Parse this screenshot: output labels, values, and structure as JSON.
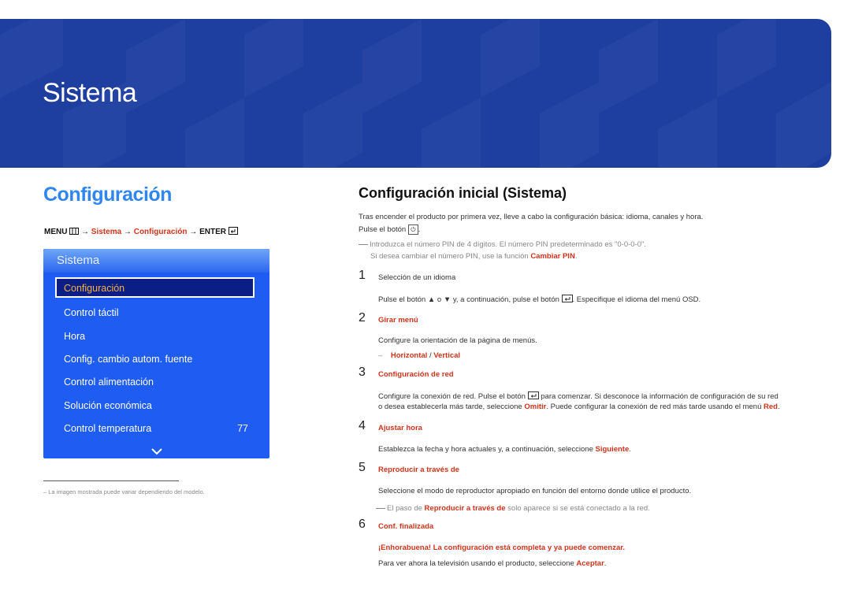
{
  "banner": {
    "title": "Sistema",
    "color": "#1f3fa0"
  },
  "section": {
    "title": "Configuración",
    "title_color": "#2f86f0"
  },
  "path": {
    "menu": "MENU",
    "arrow": "→",
    "item1": "Sistema",
    "item2": "Configuración",
    "enter": "ENTER"
  },
  "osd": {
    "title": "Sistema",
    "items": [
      {
        "label": "Configuración",
        "selected": true
      },
      {
        "label": "Control táctil"
      },
      {
        "label": "Hora"
      },
      {
        "label": "Config. cambio autom. fuente"
      },
      {
        "label": "Control alimentación"
      },
      {
        "label": "Solución económica"
      },
      {
        "label": "Control temperatura",
        "value": "77"
      }
    ]
  },
  "footnote": "La imagen mostrada puede variar dependiendo del modelo.",
  "main": {
    "title": "Configuración inicial (Sistema)",
    "intro1": "Tras encender el producto por primera vez, lleve a cabo la configuración básica: idioma, canales y hora.",
    "intro2a": "Pulse el botón",
    "intro2b": ".",
    "note1": "Introduzca el número PIN de 4 dígitos. El número PIN predeterminado es \"0-0-0-0\".",
    "note2a": "Si desea cambiar el número PIN, use la función",
    "note2b": "Cambiar PIN",
    "note2c": ".",
    "steps": [
      {
        "num": "1",
        "title": "Selección de un idioma",
        "body_a": "Pulse el botón ▲ o ▼ y, a continuación, pulse el botón",
        "body_b": ". Especifique el idioma del menú OSD."
      },
      {
        "num": "2",
        "title": "Girar menú",
        "body": "Configure la orientación de la página de menús.",
        "opt1": "Horizontal",
        "sep": " / ",
        "opt2": "Vertical"
      },
      {
        "num": "3",
        "title": "Configuración de red",
        "body_a": "Configure la conexión de red. Pulse el botón",
        "body_b": "para comenzar. Si desconoce la información de configuración de su red",
        "body_c": "o desea establecerla más tarde, seleccione",
        "body_d": "Omitir",
        "body_e": ". Puede configurar la conexión de red más tarde usando el menú",
        "body_f": "Red",
        "body_g": "."
      },
      {
        "num": "4",
        "title": "Ajustar hora",
        "body_a": "Establezca la fecha y hora actuales y, a continuación, seleccione",
        "body_b": "Siguiente",
        "body_c": "."
      },
      {
        "num": "5",
        "title": "Reproducir a través de",
        "body": "Seleccione el modo de reproductor apropiado en función del entorno donde utilice el producto.",
        "note_a": "El paso de",
        "note_b": "Reproducir a través de",
        "note_c": "solo aparece si se está conectado a la red."
      },
      {
        "num": "6",
        "title": "Conf. finalizada",
        "highlight": "¡Enhorabuena! La configuración está completa y ya puede comenzar.",
        "body_a": "Para ver ahora la televisión usando el producto, seleccione",
        "body_b": "Aceptar",
        "body_c": "."
      }
    ]
  },
  "colors": {
    "accent_red": "#d0331b",
    "osd_blue": "#1f5cf2",
    "osd_selected": "#0b1e86",
    "osd_selected_text": "#f3b23e"
  }
}
